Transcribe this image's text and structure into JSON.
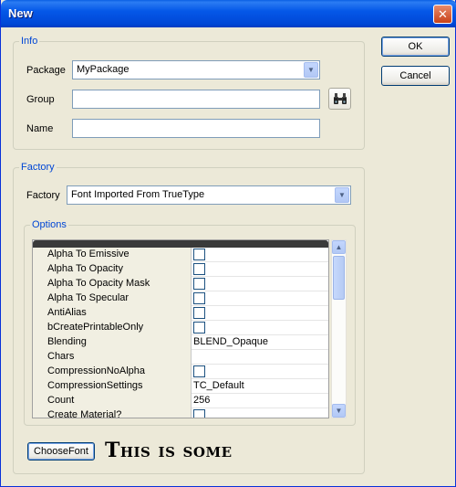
{
  "window": {
    "title": "New",
    "close_glyph": "✕"
  },
  "buttons": {
    "ok": "OK",
    "cancel": "Cancel",
    "choose_font": "ChooseFont"
  },
  "info": {
    "legend": "Info",
    "package_label": "Package",
    "package_value": "MyPackage",
    "group_label": "Group",
    "group_value": "",
    "browse_icon": "binoculars-icon",
    "name_label": "Name",
    "name_value": ""
  },
  "factory": {
    "legend": "Factory",
    "factory_label": "Factory",
    "factory_value": "Font Imported From TrueType",
    "options_legend": "Options",
    "properties": [
      {
        "name": "Alpha To Emissive",
        "type": "checkbox",
        "value": ""
      },
      {
        "name": "Alpha To Opacity",
        "type": "checkbox",
        "value": ""
      },
      {
        "name": "Alpha To Opacity Mask",
        "type": "checkbox",
        "value": ""
      },
      {
        "name": "Alpha To Specular",
        "type": "checkbox",
        "value": ""
      },
      {
        "name": "AntiAlias",
        "type": "checkbox",
        "value": ""
      },
      {
        "name": "bCreatePrintableOnly",
        "type": "checkbox",
        "value": ""
      },
      {
        "name": "Blending",
        "type": "text",
        "value": "BLEND_Opaque"
      },
      {
        "name": "Chars",
        "type": "text",
        "value": ""
      },
      {
        "name": "CompressionNoAlpha",
        "type": "checkbox",
        "value": ""
      },
      {
        "name": "CompressionSettings",
        "type": "text",
        "value": "TC_Default"
      },
      {
        "name": "Count",
        "type": "text",
        "value": "256"
      },
      {
        "name": "Create Material?",
        "type": "checkbox",
        "value": ""
      }
    ]
  },
  "font_preview": "This is some",
  "colors": {
    "title_bar": "#0058e6",
    "legend": "#0046d5",
    "dialog_bg": "#ece9d8"
  }
}
